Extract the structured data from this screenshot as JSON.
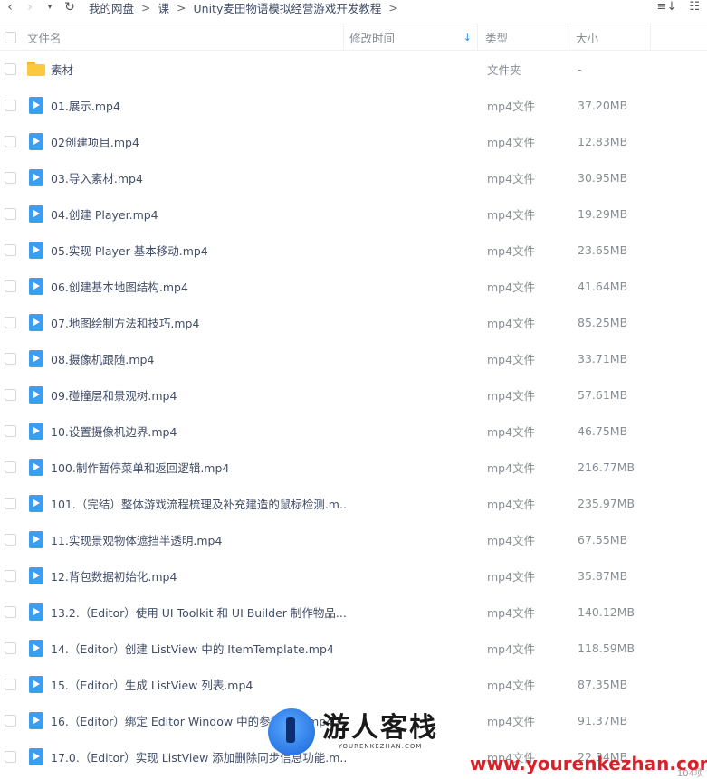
{
  "breadcrumb": [
    "我的网盘",
    "课",
    "Unity麦田物语模拟经营游戏开发教程"
  ],
  "columns": {
    "name": "文件名",
    "modified": "修改时间",
    "type": "类型",
    "size": "大小"
  },
  "rows": [
    {
      "icon": "folder-icon",
      "name": "素材",
      "type": "文件夹",
      "size": "-"
    },
    {
      "icon": "video-icon",
      "name": "01.展示.mp4",
      "type": "mp4文件",
      "size": "37.20MB"
    },
    {
      "icon": "video-icon",
      "name": "02创建项目.mp4",
      "type": "mp4文件",
      "size": "12.83MB"
    },
    {
      "icon": "video-icon",
      "name": "03.导入素材.mp4",
      "type": "mp4文件",
      "size": "30.95MB"
    },
    {
      "icon": "video-icon",
      "name": "04.创建 Player.mp4",
      "type": "mp4文件",
      "size": "19.29MB"
    },
    {
      "icon": "video-icon",
      "name": "05.实现 Player 基本移动.mp4",
      "type": "mp4文件",
      "size": "23.65MB"
    },
    {
      "icon": "video-icon",
      "name": "06.创建基本地图结构.mp4",
      "type": "mp4文件",
      "size": "41.64MB"
    },
    {
      "icon": "video-icon",
      "name": "07.地图绘制方法和技巧.mp4",
      "type": "mp4文件",
      "size": "85.25MB"
    },
    {
      "icon": "video-icon",
      "name": "08.摄像机跟随.mp4",
      "type": "mp4文件",
      "size": "33.71MB"
    },
    {
      "icon": "video-icon",
      "name": "09.碰撞层和景观树.mp4",
      "type": "mp4文件",
      "size": "57.61MB"
    },
    {
      "icon": "video-icon",
      "name": "10.设置摄像机边界.mp4",
      "type": "mp4文件",
      "size": "46.75MB"
    },
    {
      "icon": "video-icon",
      "name": "100.制作暂停菜单和返回逻辑.mp4",
      "type": "mp4文件",
      "size": "216.77MB"
    },
    {
      "icon": "video-icon",
      "name": "101.（完结）整体游戏流程梳理及补充建造的鼠标检测.m...",
      "type": "mp4文件",
      "size": "235.97MB"
    },
    {
      "icon": "video-icon",
      "name": "11.实现景观物体遮挡半透明.mp4",
      "type": "mp4文件",
      "size": "67.55MB"
    },
    {
      "icon": "video-icon",
      "name": "12.背包数据初始化.mp4",
      "type": "mp4文件",
      "size": "35.87MB"
    },
    {
      "icon": "video-icon",
      "name": "13.2.（Editor）使用 UI Toolkit 和 UI Builder 制作物品...",
      "type": "mp4文件",
      "size": "140.12MB"
    },
    {
      "icon": "video-icon",
      "name": "14.（Editor）创建 ListView 中的 ItemTemplate.mp4",
      "type": "mp4文件",
      "size": "118.59MB"
    },
    {
      "icon": "video-icon",
      "name": "15.（Editor）生成 ListView 列表.mp4",
      "type": "mp4文件",
      "size": "87.35MB"
    },
    {
      "icon": "video-icon",
      "name": "16.（Editor）绑定 Editor Window 中的参数变量.mp4",
      "type": "mp4文件",
      "size": "91.37MB"
    },
    {
      "icon": "video-icon",
      "name": "17.0.（Editor）实现 ListView 添加删除同步信息功能.m...",
      "type": "mp4文件",
      "size": "22.34MB"
    }
  ],
  "watermark": {
    "name": "游人客栈",
    "domain": "YOURENKEZHAN.COM",
    "url": "www.yourenkezhan.com"
  },
  "item_count": "104项",
  "colors": {
    "accent": "#3e9cf1",
    "folder": "#fcc83e",
    "watermark_red": "#d6232b"
  }
}
